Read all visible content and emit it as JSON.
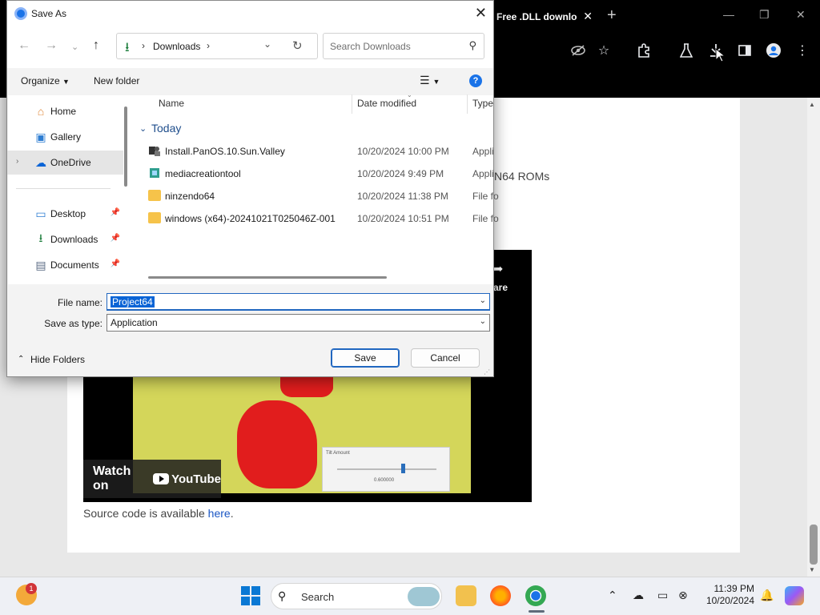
{
  "browser": {
    "tab_title": "Free .DLL downlo",
    "tab_close": "✕",
    "new_tab": "+",
    "window_controls": {
      "minimize": "—",
      "restore": "❐",
      "close": "✕"
    },
    "toolbar_icons": [
      "eye-off-icon",
      "star-icon",
      "extensions-icon",
      "labs-flask-icon",
      "downloads-icon",
      "sidebar-icon",
      "profile-icon",
      "kebab-menu-icon"
    ]
  },
  "webpage": {
    "partial_text": "N64 ROMs",
    "share_label": "are",
    "watch_on_label": "Watch on",
    "youtube_label": "YouTube",
    "game_panel_title": "Tilt Amount",
    "game_panel_value": "0.600000",
    "source_prefix": "Source code is available ",
    "source_link": "here",
    "source_suffix": "."
  },
  "dialog": {
    "title": "Save As",
    "close_glyph": "✕",
    "address": {
      "segment": "Downloads",
      "sep_before": "›",
      "sep_after": "›"
    },
    "search_placeholder": "Search Downloads",
    "organize_label": "Organize",
    "new_folder_label": "New folder",
    "help_glyph": "?",
    "nav_items": [
      {
        "label": "Home",
        "icon": "home-icon"
      },
      {
        "label": "Gallery",
        "icon": "gallery-icon"
      },
      {
        "label": "OneDrive",
        "icon": "onedrive-icon",
        "selected": true
      },
      {
        "label": "Desktop",
        "icon": "desktop-icon",
        "pinned": true
      },
      {
        "label": "Downloads",
        "icon": "download-icon",
        "pinned": true
      },
      {
        "label": "Documents",
        "icon": "documents-icon",
        "pinned": true
      }
    ],
    "columns": {
      "name": "Name",
      "date": "Date modified",
      "type": "Type"
    },
    "group_label": "Today",
    "files": [
      {
        "name": "Install.PanOS.10.Sun.Valley",
        "date": "10/20/2024 10:00 PM",
        "type": "Appli",
        "icon": "installer-icon"
      },
      {
        "name": "mediacreationtool",
        "date": "10/20/2024 9:49 PM",
        "type": "Appli",
        "icon": "app-icon"
      },
      {
        "name": "ninzendo64",
        "date": "10/20/2024 11:38 PM",
        "type": "File fo",
        "icon": "folder-icon"
      },
      {
        "name": "windows (x64)-20241021T025046Z-001",
        "date": "10/20/2024 10:51 PM",
        "type": "File fo",
        "icon": "folder-icon"
      }
    ],
    "file_name_label": "File name:",
    "file_name_value": "Project64",
    "save_type_label": "Save as type:",
    "save_type_value": "Application",
    "hide_folders_label": "Hide Folders",
    "save_label": "Save",
    "cancel_label": "Cancel"
  },
  "taskbar": {
    "weather_badge": "1",
    "search_label": "Search",
    "apps": [
      "file-explorer-icon",
      "firefox-icon",
      "chrome-icon"
    ],
    "time": "11:39 PM",
    "date": "10/20/2024"
  },
  "colors": {
    "accent": "#0a64d6",
    "chrome_bg": "#000000",
    "dialog_bg": "#f3f3f3",
    "folder": "#f6c34a"
  }
}
